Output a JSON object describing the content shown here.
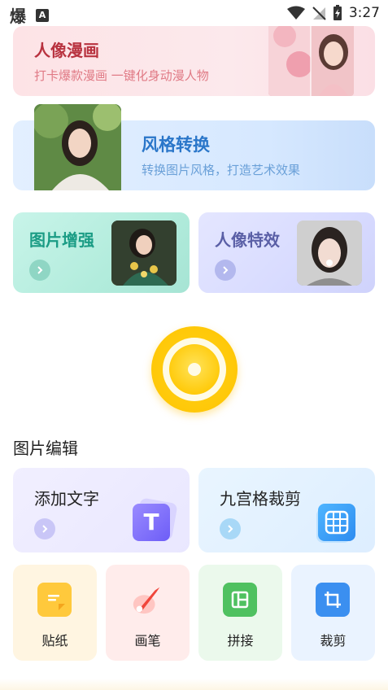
{
  "status_bar": {
    "app_glyph": "爆",
    "notif_glyph": "A",
    "time": "3:27"
  },
  "banners": {
    "manga": {
      "title": "人像漫画",
      "subtitle": "打卡爆款漫画  一键化身动漫人物"
    },
    "style": {
      "title": "风格转换",
      "subtitle": "转换图片风格，打造艺术效果"
    },
    "enhance": {
      "title": "图片增强"
    },
    "effects": {
      "title": "人像特效"
    }
  },
  "camera": {
    "icon": "camera-shutter-icon"
  },
  "edit_section": {
    "title": "图片编辑",
    "add_text": {
      "title": "添加文字",
      "icon_glyph": "T"
    },
    "grid9": {
      "title": "九宫格裁剪"
    }
  },
  "tools": [
    {
      "label": "贴纸",
      "icon": "sticker-icon"
    },
    {
      "label": "画笔",
      "icon": "brush-icon"
    },
    {
      "label": "拼接",
      "icon": "stitch-icon"
    },
    {
      "label": "裁剪",
      "icon": "crop-icon"
    }
  ],
  "colors": {
    "camera_yellow": "#ffc400",
    "manga_title": "#b8323f",
    "style_title": "#2a76c9",
    "enhance_title": "#1b9c85",
    "effects_title": "#5a5fa6"
  }
}
